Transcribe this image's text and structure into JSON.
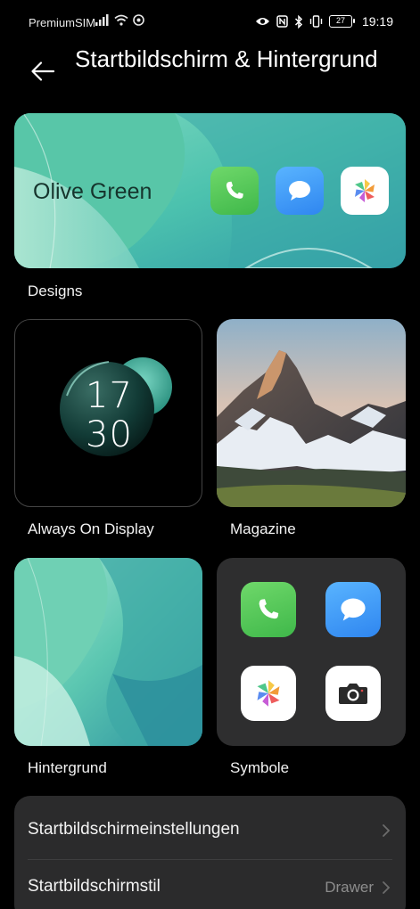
{
  "status_bar": {
    "carrier": "PremiumSIM",
    "battery_level": "27",
    "time": "19:19",
    "icons": [
      "signal-icon",
      "wifi-icon",
      "hotspot-icon",
      "eye-comfort-icon",
      "nfc-icon",
      "bluetooth-icon",
      "vibrate-icon"
    ]
  },
  "header": {
    "back_icon": "arrow-left-icon",
    "title": "Startbildschirm & Hintergrund"
  },
  "designs": {
    "theme_name": "Olive Green",
    "label": "Designs",
    "preview_icons": [
      "phone-icon",
      "messages-icon",
      "gallery-icon"
    ]
  },
  "aod": {
    "label": "Always On Display",
    "hour": "17",
    "minute": "30"
  },
  "magazine": {
    "label": "Magazine"
  },
  "wallpaper": {
    "label": "Hintergrund"
  },
  "icons": {
    "label": "Symbole",
    "preview_icons": [
      "phone-icon",
      "messages-icon",
      "gallery-icon",
      "camera-icon"
    ]
  },
  "settings": [
    {
      "label": "Startbildschirmeinstellungen",
      "value": ""
    },
    {
      "label": "Startbildschirmstil",
      "value": "Drawer"
    }
  ],
  "colors": {
    "background": "#000000",
    "card": "#2b2b2c",
    "theme_teal": "#3fbfa6",
    "phone_green": "#4cc552",
    "messages_blue": "#3a93f5"
  }
}
